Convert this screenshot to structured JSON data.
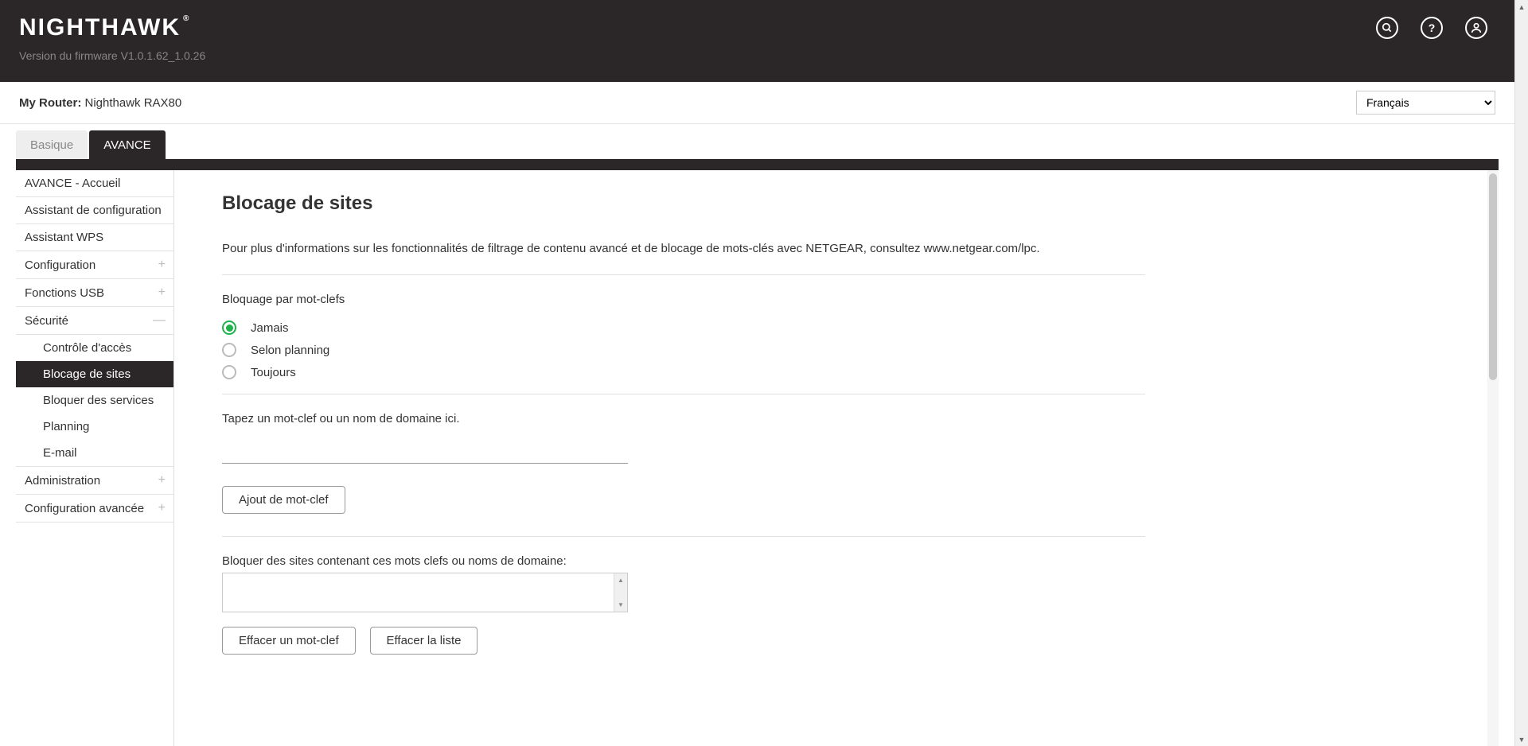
{
  "brand": "NIGHTHAWK",
  "firmware_label": "Version du firmware V1.0.1.62_1.0.26",
  "router_prefix": "My Router:",
  "router_name": "Nighthawk RAX80",
  "language": "Français",
  "tabs": {
    "basic": "Basique",
    "advanced": "AVANCE"
  },
  "sidebar": {
    "home": "AVANCE - Accueil",
    "setup_wizard": "Assistant de configuration",
    "wps_wizard": "Assistant WPS",
    "configuration": "Configuration",
    "usb": "Fonctions USB",
    "security": "Sécurité",
    "security_items": {
      "access": "Contrôle d'accès",
      "block_sites": "Blocage de sites",
      "block_services": "Bloquer des services",
      "planning": "Planning",
      "email": "E-mail"
    },
    "administration": "Administration",
    "advanced_config": "Configuration avancée"
  },
  "page": {
    "title": "Blocage de sites",
    "info": "Pour plus d'informations sur les fonctionnalités de filtrage de contenu avancé et de blocage de mots-clés avec NETGEAR, consultez www.netgear.com/lpc.",
    "keyword_section": "Bloquage par mot-clefs",
    "radio_never": "Jamais",
    "radio_schedule": "Selon planning",
    "radio_always": "Toujours",
    "keyword_prompt": "Tapez un mot-clef ou un nom de domaine ici.",
    "add_keyword_btn": "Ajout de mot-clef",
    "block_list_prompt": "Bloquer des sites contenant ces mots clefs ou noms de domaine:",
    "delete_keyword_btn": "Effacer un mot-clef",
    "clear_list_btn": "Effacer la liste"
  }
}
